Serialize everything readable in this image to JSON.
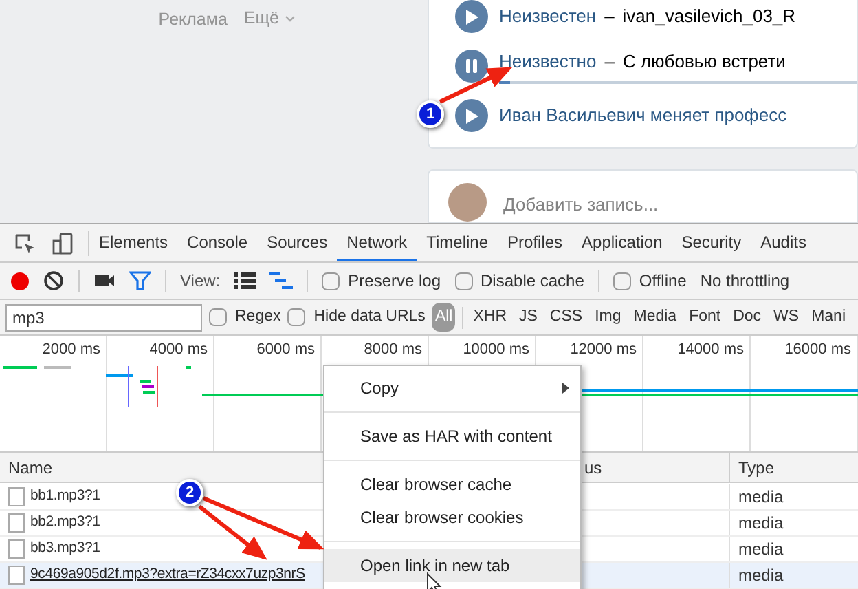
{
  "page": {
    "footer_links": [
      "Реклама",
      "Ещё"
    ],
    "audio": [
      {
        "kind": "play",
        "artist": "Неизвестен",
        "separator": "–",
        "title": "ivan_vasilevich_03_R"
      },
      {
        "kind": "pause",
        "artist": "Неизвестно",
        "separator": "–",
        "title": "С любовью встрети",
        "level": 0.03
      },
      {
        "kind": "play",
        "title": "Иван Васильевич меняет професс"
      }
    ],
    "post_placeholder": "Добавить запись..."
  },
  "devtools": {
    "tabs": [
      {
        "label": "Elements",
        "selected": false
      },
      {
        "label": "Console",
        "selected": false
      },
      {
        "label": "Sources",
        "selected": false
      },
      {
        "label": "Network",
        "selected": true
      },
      {
        "label": "Timeline",
        "selected": false
      },
      {
        "label": "Profiles",
        "selected": false
      },
      {
        "label": "Application",
        "selected": false
      },
      {
        "label": "Security",
        "selected": false
      },
      {
        "label": "Audits",
        "selected": false
      }
    ],
    "recording": true,
    "filter_on": true,
    "view_label": "View:",
    "large_rows": false,
    "options": [
      {
        "label": "Preserve log",
        "checked": false
      },
      {
        "label": "Disable cache",
        "checked": false
      },
      {
        "label": "Offline",
        "checked": false
      }
    ],
    "throttling": "No throttling",
    "filter": {
      "value": "mp3",
      "regex": {
        "label": "Regex",
        "checked": false
      },
      "hide_data": {
        "label": "Hide data URLs",
        "checked": false
      }
    },
    "types": [
      {
        "label": "All",
        "selected": true
      },
      {
        "label": "XHR",
        "selected": false
      },
      {
        "label": "JS",
        "selected": false
      },
      {
        "label": "CSS",
        "selected": false
      },
      {
        "label": "Img",
        "selected": false
      },
      {
        "label": "Media",
        "selected": false
      },
      {
        "label": "Font",
        "selected": false
      },
      {
        "label": "Doc",
        "selected": false
      },
      {
        "label": "WS",
        "selected": false
      },
      {
        "label": "Mani",
        "selected": false
      }
    ],
    "ticks": [
      "2000 ms",
      "4000 ms",
      "6000 ms",
      "8000 ms",
      "10000 ms",
      "12000 ms",
      "14000 ms",
      "16000 ms"
    ],
    "columns": [
      "Name",
      "us",
      "Type"
    ],
    "rows": [
      {
        "name": "bb1.mp3?1",
        "type": "media",
        "selected": false
      },
      {
        "name": "bb2.mp3?1",
        "type": "media",
        "selected": false
      },
      {
        "name": "bb3.mp3?1",
        "type": "media",
        "selected": false
      },
      {
        "name": "9c469a905d2f.mp3?extra=rZ34cxx7uzp3nrS",
        "type": "media",
        "selected": true
      }
    ]
  },
  "context_menu": [
    {
      "kind": "submenu",
      "label": "Copy",
      "highlighted": false
    },
    {
      "kind": "separator"
    },
    {
      "kind": "item",
      "label": "Save as HAR with content",
      "highlighted": false
    },
    {
      "kind": "separator"
    },
    {
      "kind": "item",
      "label": "Clear browser cache",
      "highlighted": false
    },
    {
      "kind": "item",
      "label": "Clear browser cookies",
      "highlighted": false
    },
    {
      "kind": "separator"
    },
    {
      "kind": "item",
      "label": "Open link in new tab",
      "highlighted": true
    }
  ],
  "annotations": [
    "1",
    "2"
  ]
}
